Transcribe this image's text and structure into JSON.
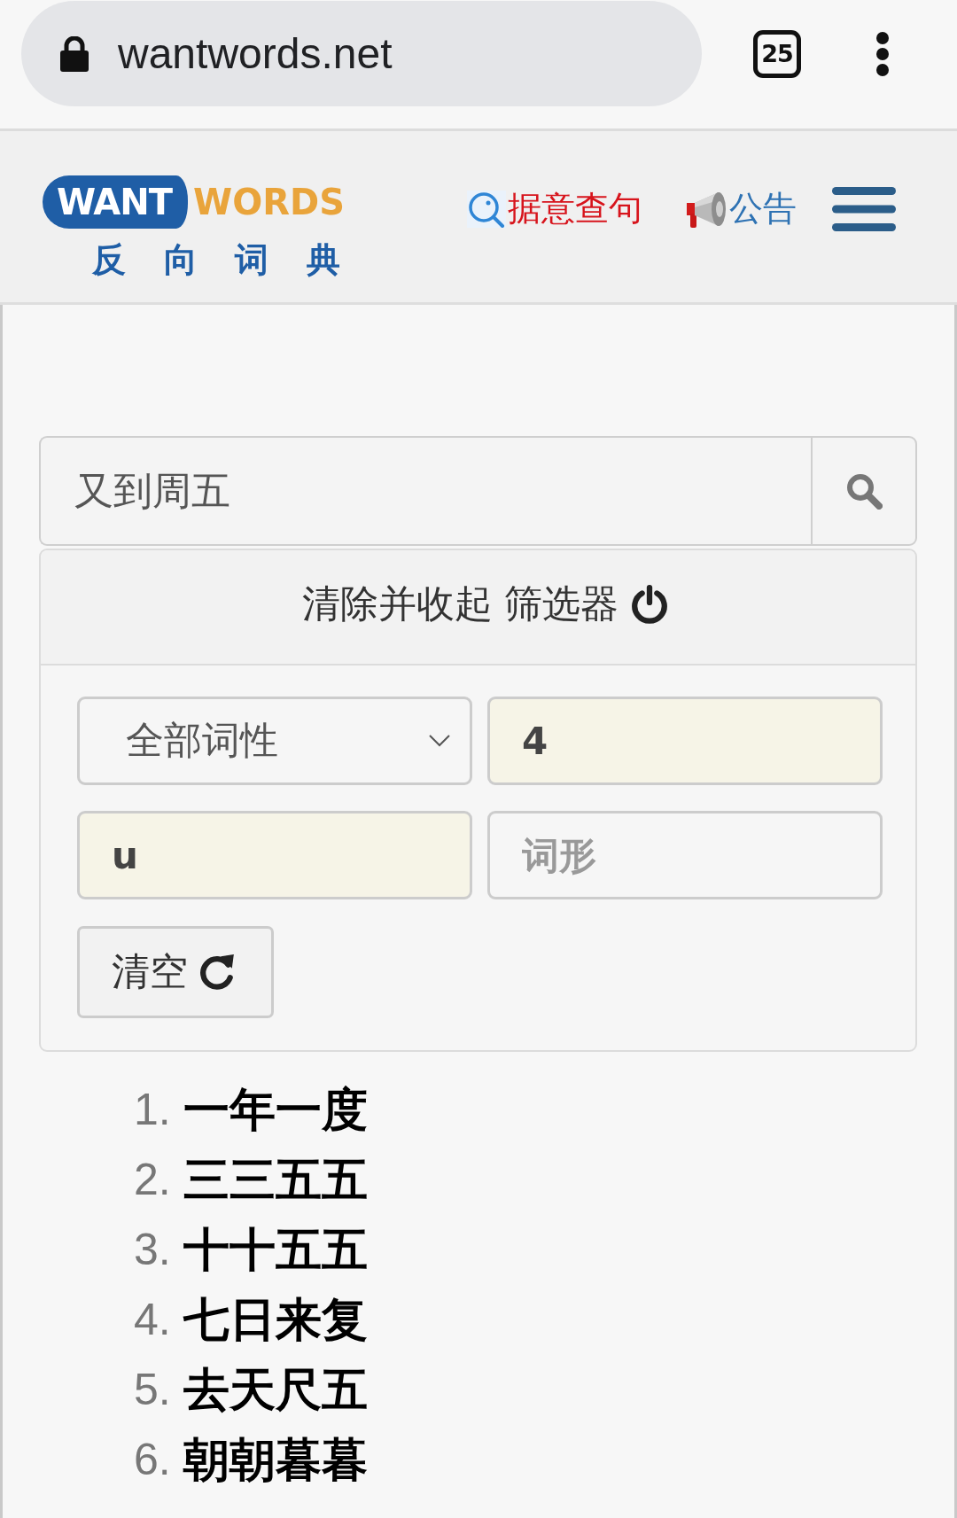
{
  "browser": {
    "url": "wantwords.net",
    "tab_count": "25"
  },
  "header": {
    "logo": {
      "word_1": "WANT",
      "word_2": "WORDS",
      "subtitle": "反 向 词 典"
    },
    "nav": [
      {
        "kind": "search",
        "label": "据意查句"
      },
      {
        "kind": "notice",
        "label": "公告"
      }
    ]
  },
  "search": {
    "value": "又到周五"
  },
  "filter": {
    "toggle_label": "清除并收起 筛选器",
    "fields": [
      {
        "kind": "select",
        "value": "全部词性",
        "highlighted": false
      },
      {
        "kind": "input",
        "value": "4",
        "highlighted": true
      },
      {
        "kind": "input",
        "value": "u",
        "highlighted": true
      },
      {
        "kind": "input",
        "placeholder": "词形",
        "highlighted": false
      }
    ],
    "clear_button": "清空"
  },
  "results": [
    {
      "number": "1.",
      "word": "一年一度"
    },
    {
      "number": "2.",
      "word": "三三五五"
    },
    {
      "number": "3.",
      "word": "十十五五"
    },
    {
      "number": "4.",
      "word": "七日来复"
    },
    {
      "number": "5.",
      "word": "去天尺五"
    },
    {
      "number": "6.",
      "word": "朝朝暮暮"
    }
  ]
}
